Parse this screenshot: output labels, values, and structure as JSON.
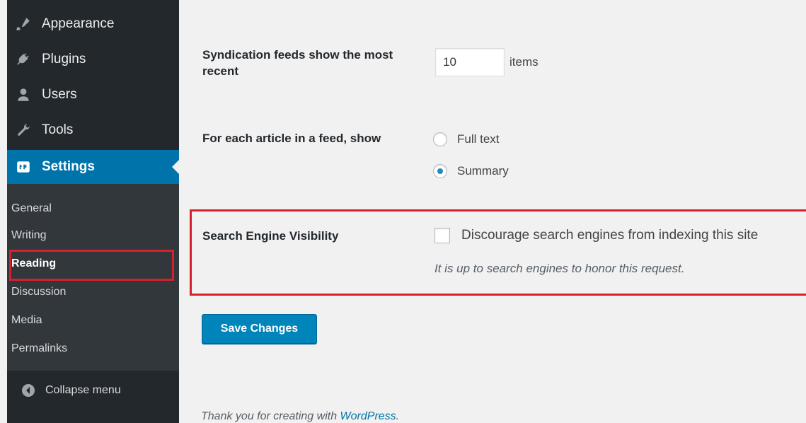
{
  "sidebar": {
    "menu": [
      {
        "label": "Appearance",
        "icon": "paintbrush-icon"
      },
      {
        "label": "Plugins",
        "icon": "plug-icon"
      },
      {
        "label": "Users",
        "icon": "users-icon"
      },
      {
        "label": "Tools",
        "icon": "wrench-icon"
      },
      {
        "label": "Settings",
        "icon": "settings-icon"
      }
    ],
    "submenu": [
      "General",
      "Writing",
      "Reading",
      "Discussion",
      "Media",
      "Permalinks"
    ],
    "collapse_label": "Collapse menu"
  },
  "settings": {
    "syndication_label": "Syndication feeds show the most recent",
    "syndication_value": "10",
    "syndication_unit": "items",
    "feed_label": "For each article in a feed, show",
    "feed_options": [
      "Full text",
      "Summary"
    ],
    "feed_selected": "Summary",
    "visibility_label": "Search Engine Visibility",
    "visibility_checkbox": "Discourage search engines from indexing this site",
    "visibility_checked": false,
    "visibility_note": "It is up to search engines to honor this request.",
    "save_label": "Save Changes"
  },
  "footer": {
    "prefix": "Thank you for creating with ",
    "link": "WordPress",
    "suffix": "."
  },
  "colors": {
    "sidebar_bg": "#23282d",
    "submenu_bg": "#32373c",
    "accent": "#0073aa",
    "highlight_border": "#d6202d",
    "content_bg": "#f1f1f1"
  }
}
